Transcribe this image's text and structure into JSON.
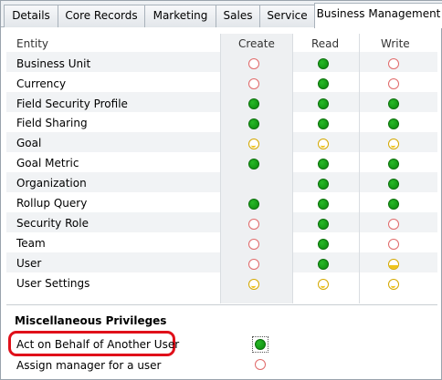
{
  "tabs": [
    {
      "label": "Details",
      "active": false
    },
    {
      "label": "Core Records",
      "active": false
    },
    {
      "label": "Marketing",
      "active": false
    },
    {
      "label": "Sales",
      "active": false
    },
    {
      "label": "Service",
      "active": false
    },
    {
      "label": "Business Management",
      "active": true
    }
  ],
  "table": {
    "headers": {
      "entity": "Entity",
      "create": "Create",
      "read": "Read",
      "write": "Write"
    },
    "rows": [
      {
        "entity": "Business Unit",
        "create": "none",
        "read": "organization",
        "write": "none"
      },
      {
        "entity": "Currency",
        "create": "none",
        "read": "organization",
        "write": "none"
      },
      {
        "entity": "Field Security Profile",
        "create": "organization",
        "read": "organization",
        "write": "organization"
      },
      {
        "entity": "Field Sharing",
        "create": "organization",
        "read": "organization",
        "write": "organization"
      },
      {
        "entity": "Goal",
        "create": "business-unit",
        "read": "business-unit",
        "write": "business-unit"
      },
      {
        "entity": "Goal Metric",
        "create": "organization",
        "read": "organization",
        "write": "organization"
      },
      {
        "entity": "Organization",
        "create": "",
        "read": "organization",
        "write": "organization"
      },
      {
        "entity": "Rollup Query",
        "create": "organization",
        "read": "organization",
        "write": "organization"
      },
      {
        "entity": "Security Role",
        "create": "none",
        "read": "organization",
        "write": "none"
      },
      {
        "entity": "Team",
        "create": "none",
        "read": "organization",
        "write": "none"
      },
      {
        "entity": "User",
        "create": "none",
        "read": "organization",
        "write": "user"
      },
      {
        "entity": "User Settings",
        "create": "business-unit",
        "read": "business-unit",
        "write": "business-unit"
      }
    ]
  },
  "misc": {
    "title": "Miscellaneous Privileges",
    "items": [
      {
        "label": "Act on Behalf of Another User",
        "level": "organization",
        "highlighted": true
      },
      {
        "label": "Assign manager for a user",
        "level": "none",
        "highlighted": false
      }
    ]
  },
  "colors": {
    "highlight": "#e0101a",
    "organization": "#15a315",
    "none": "#e06a6a",
    "user": "#f0c419"
  }
}
